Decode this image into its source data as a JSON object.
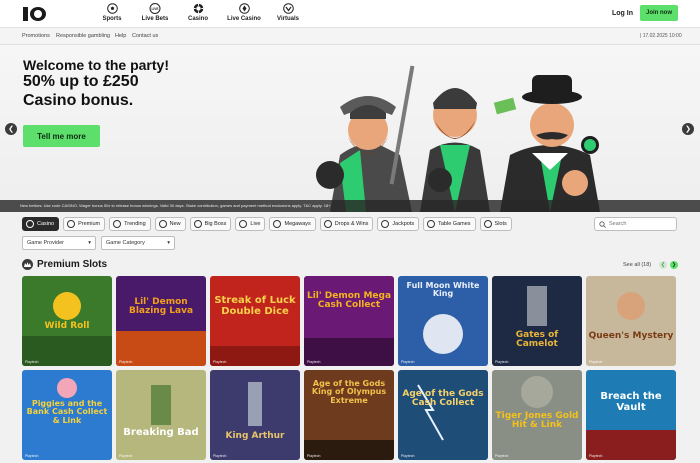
{
  "brand": {
    "logo_text": "10"
  },
  "nav": {
    "items": [
      {
        "label": "Sports",
        "icon": "soccer-ball-icon"
      },
      {
        "label": "Live Bets",
        "icon": "live-badge-icon"
      },
      {
        "label": "Casino",
        "icon": "casino-chip-icon"
      },
      {
        "label": "Live Casino",
        "icon": "dealer-icon"
      },
      {
        "label": "Virtuals",
        "icon": "virtuals-icon"
      }
    ],
    "login_label": "Log In",
    "join_label": "Join now"
  },
  "subnav": {
    "links": [
      "Promotions",
      "Responsible gambling",
      "Help",
      "Contact us"
    ],
    "datetime": "| 17.02.2025 10:00"
  },
  "hero": {
    "line1": "Welcome to the party!",
    "line2": "50% up to £250",
    "line3": "Casino bonus.",
    "cta_label": "Tell me more",
    "terms": "New bettors: Use code CASINO. Wager bonus 50x to release bonus winnings. Valid 30 days. Stake contribution, games and payment method exclusions apply. T&C apply. 18+"
  },
  "filters": {
    "chips": [
      "Casino",
      "Premium",
      "Trending",
      "New",
      "Big Boss",
      "Live",
      "Megaways",
      "Drops & Wins",
      "Jackpots",
      "Table Games",
      "Slots"
    ],
    "active": "Casino",
    "search_placeholder": "Search"
  },
  "selects": {
    "provider": "Game Provider",
    "category": "Game Category"
  },
  "section": {
    "title": "Premium Slots",
    "see_all": "See all (18)"
  },
  "games": [
    {
      "title": "Wild Roll",
      "provider": "Playtech",
      "bg": "#3a7a2a",
      "accent": "#f4c21f"
    },
    {
      "title": "Lil' Demon Blazing Lava",
      "provider": "Playtech",
      "bg": "#4a1a6a",
      "accent": "#f2a01c"
    },
    {
      "title": "Streak of Luck Double Dice",
      "provider": "Playtech",
      "bg": "#c1241c",
      "accent": "#f6d24a"
    },
    {
      "title": "Lil' Demon Mega Cash Collect",
      "provider": "Playtech",
      "bg": "#6a1a74",
      "accent": "#f5b41d"
    },
    {
      "title": "Full Moon White King",
      "provider": "Playtech",
      "bg": "#2c5fa8",
      "accent": "#e9eef8"
    },
    {
      "title": "Gates of Camelot",
      "provider": "Playtech",
      "bg": "#1e2a44",
      "accent": "#e8b53a"
    },
    {
      "title": "Queen's Mystery",
      "provider": "Playtech",
      "bg": "#c7b89c",
      "accent": "#7a3b14"
    },
    {
      "title": "Piggies and the Bank Cash Collect & Link",
      "provider": "Playtech",
      "bg": "#2d7bd0",
      "accent": "#f5d23a"
    },
    {
      "title": "Breaking Bad",
      "provider": "Playtech",
      "bg": "#b6b77c",
      "accent": "#ffffff"
    },
    {
      "title": "King Arthur",
      "provider": "Playtech",
      "bg": "#3d3a6d",
      "accent": "#e6c56a"
    },
    {
      "title": "Age of the Gods King of Olympus Extreme",
      "provider": "Playtech",
      "bg": "#6e3b1e",
      "accent": "#f2c24b"
    },
    {
      "title": "Age of the Gods Cash Collect",
      "provider": "Playtech",
      "bg": "#1e4d78",
      "accent": "#f6d16a"
    },
    {
      "title": "Tiger Jones Gold Hit & Link",
      "provider": "Playtech",
      "bg": "#8a8f86",
      "accent": "#f2c21c"
    },
    {
      "title": "Breach the Vault",
      "provider": "Playtech",
      "bg": "#1e7bb3",
      "accent": "#ffffff"
    }
  ],
  "colors": {
    "accent": "#5de06b",
    "dark": "#2a2a2a",
    "page_bg": "#f1f1f1"
  }
}
